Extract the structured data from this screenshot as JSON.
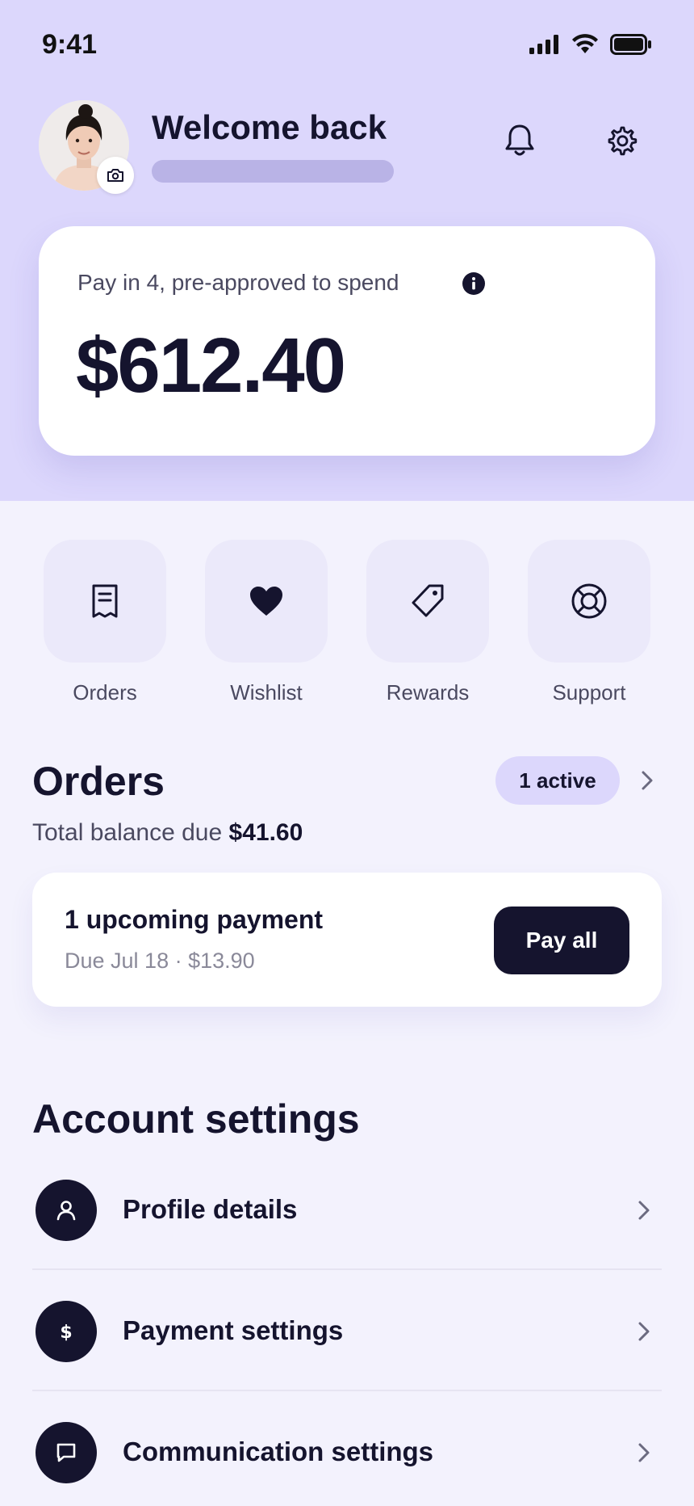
{
  "status_bar": {
    "time": "9:41"
  },
  "header": {
    "welcome": "Welcome back"
  },
  "balance_card": {
    "label": "Pay in 4, pre-approved to spend",
    "amount": "$612.40"
  },
  "quick_actions": [
    {
      "label": "Orders",
      "icon": "receipt-icon"
    },
    {
      "label": "Wishlist",
      "icon": "heart-icon"
    },
    {
      "label": "Rewards",
      "icon": "tag-icon"
    },
    {
      "label": "Support",
      "icon": "lifebuoy-icon"
    }
  ],
  "orders": {
    "title": "Orders",
    "active_badge": "1 active",
    "balance_label": "Total balance due",
    "balance_value": "$41.60",
    "payment": {
      "title": "1 upcoming payment",
      "subtitle": "Due Jul 18 · $13.90",
      "button": "Pay all"
    }
  },
  "settings": {
    "title": "Account settings",
    "items": [
      {
        "label": "Profile details",
        "icon": "user-icon"
      },
      {
        "label": "Payment settings",
        "icon": "dollar-icon"
      },
      {
        "label": "Communication settings",
        "icon": "message-icon"
      }
    ]
  },
  "colors": {
    "hero_bg": "#dcd7fc",
    "page_bg": "#f3f2fd",
    "ink": "#15142e",
    "badge_bg": "#dcd7fc"
  }
}
